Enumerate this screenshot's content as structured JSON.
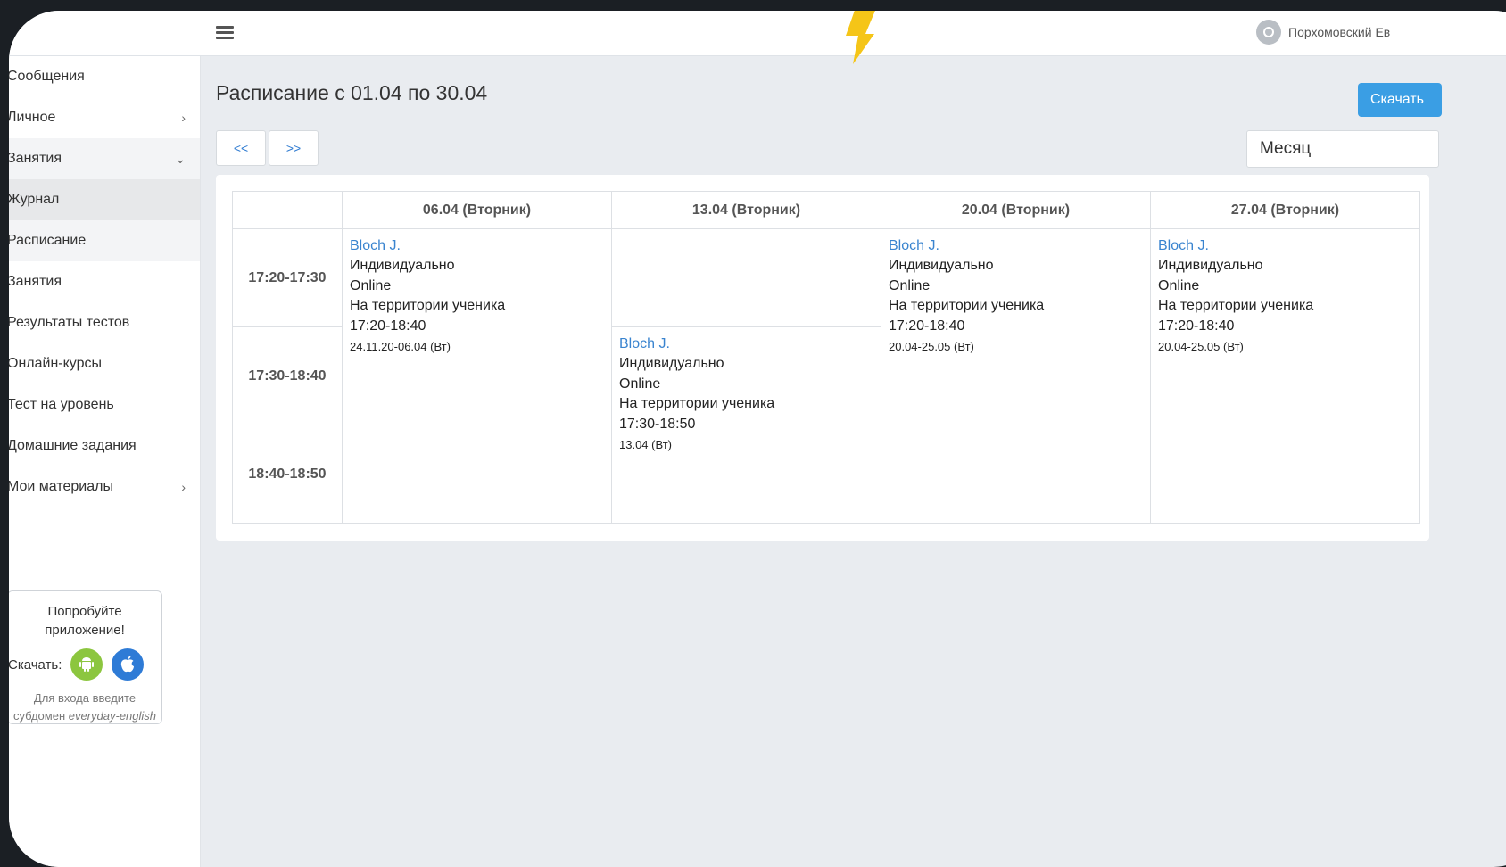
{
  "header": {
    "user_name": "Порхомовский Ев"
  },
  "sidebar": {
    "items": [
      {
        "label": "Сообщения"
      },
      {
        "label": "Личное"
      },
      {
        "label": "Занятия"
      },
      {
        "label": "Журнал"
      },
      {
        "label": "Расписание"
      },
      {
        "label": "Занятия"
      },
      {
        "label": "Результаты тестов"
      },
      {
        "label": "Онлайн-курсы"
      },
      {
        "label": "Тест на уровень"
      },
      {
        "label": "Домашние задания"
      },
      {
        "label": "Мои материалы"
      }
    ],
    "promo": {
      "title": "Попробуйте приложение!",
      "download_label": "Скачать:",
      "note_prefix": "Для входа введите субдомен",
      "note_domain": "everyday-english"
    }
  },
  "main": {
    "title": "Расписание с 01.04 по 30.04",
    "download_button": "Скачать",
    "prev_label": "<<",
    "next_label": ">>",
    "period_value": "Месяц",
    "columns": [
      "06.04 (Вторник)",
      "13.04 (Вторник)",
      "20.04 (Вторник)",
      "27.04 (Вторник)"
    ],
    "times": [
      "17:20-17:30",
      "17:30-18:40",
      "18:40-18:50"
    ],
    "lessons": {
      "c1": {
        "teacher": "Bloch J.",
        "type": "Индивидуально",
        "format": "Online",
        "place": "На территории ученика",
        "time": "17:20-18:40",
        "dates": "24.11.20-06.04 (Вт)"
      },
      "c2": {
        "teacher": "Bloch J.",
        "type": "Индивидуально",
        "format": "Online",
        "place": "На территории ученика",
        "time": "17:30-18:50",
        "dates": "13.04 (Вт)"
      },
      "c3": {
        "teacher": "Bloch J.",
        "type": "Индивидуально",
        "format": "Online",
        "place": "На территории ученика",
        "time": "17:20-18:40",
        "dates": "20.04-25.05 (Вт)"
      },
      "c4": {
        "teacher": "Bloch J.",
        "type": "Индивидуально",
        "format": "Online",
        "place": "На территории ученика",
        "time": "17:20-18:40",
        "dates": "20.04-25.05 (Вт)"
      }
    }
  },
  "icons": {
    "menu": "hamburger-icon",
    "chevron_right": "chevron-right-icon",
    "chevron_down": "chevron-down-icon",
    "android": "android-icon",
    "apple": "apple-icon",
    "avatar": "user-avatar-icon"
  },
  "colors": {
    "link": "#3a84cf",
    "primary_button": "#3a9ee4",
    "accent_bolt": "#f5c518"
  }
}
